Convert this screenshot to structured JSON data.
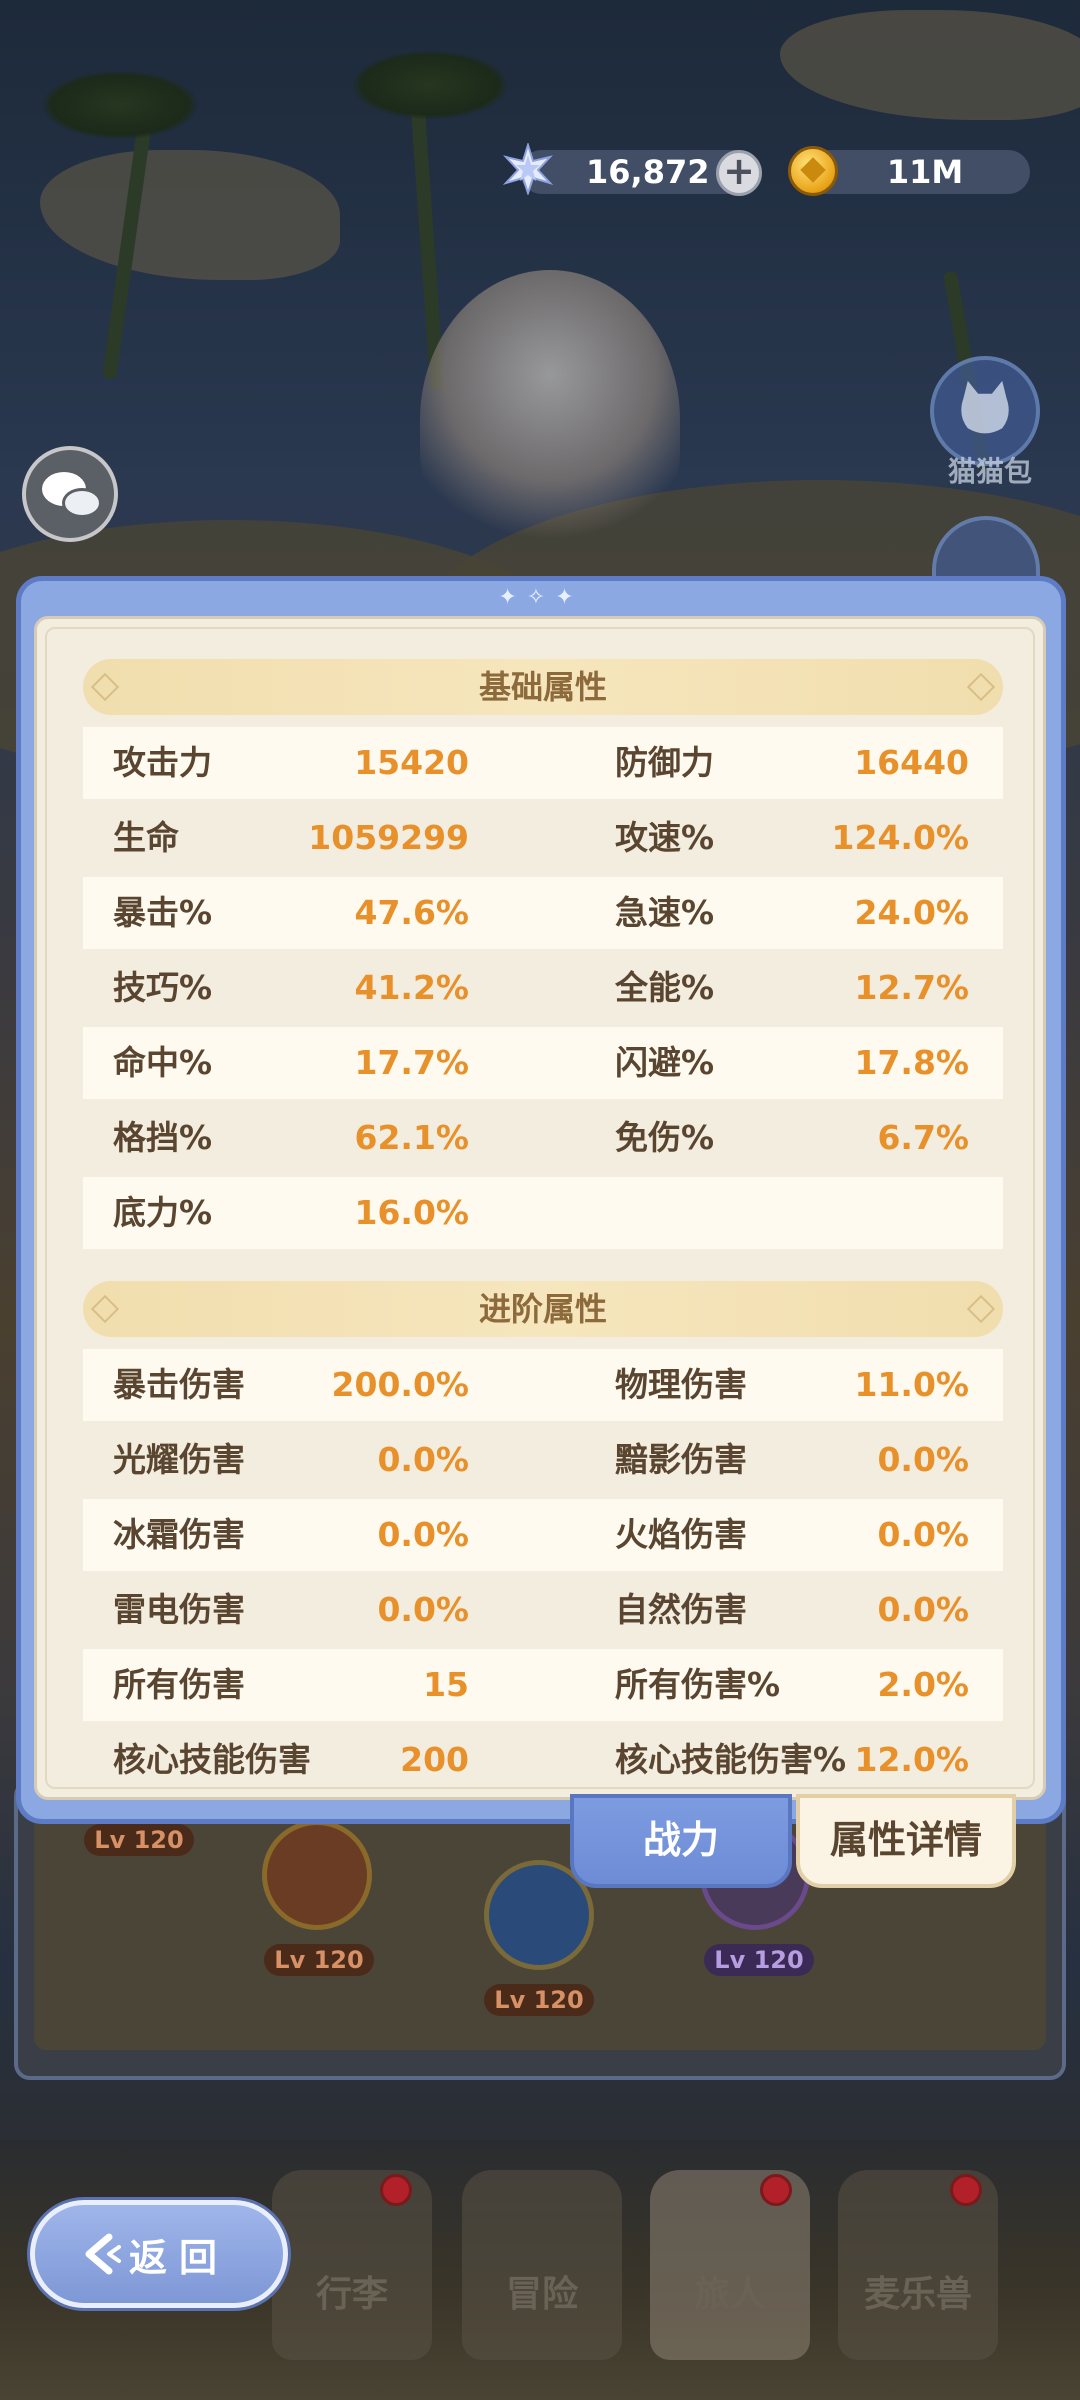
{
  "currency": {
    "gems": "16,872",
    "gold": "11M",
    "gem_icon": "star-gem-icon",
    "gold_icon": "coin-icon"
  },
  "side": {
    "catbag_label": "猫猫包"
  },
  "basic_section": {
    "title": "基础属性",
    "rows": [
      {
        "k1": "攻击力",
        "v1": "15420",
        "k2": "防御力",
        "v2": "16440"
      },
      {
        "k1": "生命",
        "v1": "1059299",
        "k2": "攻速%",
        "v2": "124.0%"
      },
      {
        "k1": "暴击%",
        "v1": "47.6%",
        "k2": "急速%",
        "v2": "24.0%"
      },
      {
        "k1": "技巧%",
        "v1": "41.2%",
        "k2": "全能%",
        "v2": "12.7%"
      },
      {
        "k1": "命中%",
        "v1": "17.7%",
        "k2": "闪避%",
        "v2": "17.8%"
      },
      {
        "k1": "格挡%",
        "v1": "62.1%",
        "k2": "免伤%",
        "v2": "6.7%"
      },
      {
        "k1": "底力%",
        "v1": "16.0%",
        "k2": "",
        "v2": ""
      }
    ]
  },
  "advanced_section": {
    "title": "进阶属性",
    "rows": [
      {
        "k1": "暴击伤害",
        "v1": "200.0%",
        "k2": "物理伤害",
        "v2": "11.0%"
      },
      {
        "k1": "光耀伤害",
        "v1": "0.0%",
        "k2": "黯影伤害",
        "v2": "0.0%"
      },
      {
        "k1": "冰霜伤害",
        "v1": "0.0%",
        "k2": "火焰伤害",
        "v2": "0.0%"
      },
      {
        "k1": "雷电伤害",
        "v1": "0.0%",
        "k2": "自然伤害",
        "v2": "0.0%"
      },
      {
        "k1": "所有伤害",
        "v1": "15",
        "k2": "所有伤害%",
        "v2": "2.0%"
      },
      {
        "k1": "核心技能伤害",
        "v1": "200",
        "k2": "核心技能伤害%",
        "v2": "12.0%"
      }
    ]
  },
  "tabs": {
    "power": "战力",
    "detail": "属性详情"
  },
  "skill_tree": {
    "levels": [
      "Lv 120",
      "Lv 120",
      "Lv 120",
      "Lv 120"
    ]
  },
  "nav": {
    "back_label": "返回",
    "items": [
      "行李",
      "冒险",
      "旅人",
      "麦乐兽"
    ]
  }
}
